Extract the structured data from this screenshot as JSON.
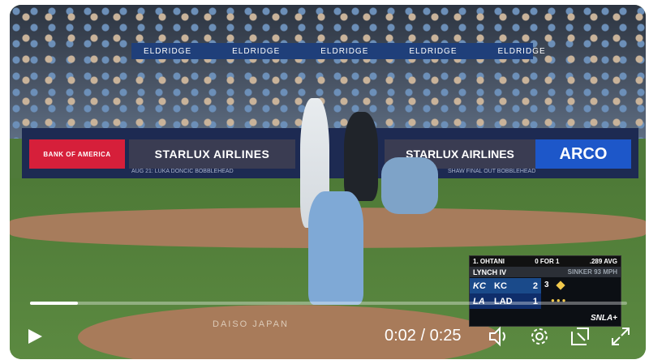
{
  "ads": {
    "eldridge": [
      "ELDRIDGE",
      "ELDRIDGE",
      "ELDRIDGE",
      "ELDRIDGE",
      "ELDRIDGE"
    ],
    "bank": "BANK OF AMERICA",
    "starlux": "STARLUX AIRLINES",
    "arco": "ARCO",
    "promo1": "AUG 21: LUKA DONCIC BOBBLEHEAD",
    "promo2": "SHAW FINAL OUT BOBBLEHEAD",
    "mound": "DAISO JAPAN"
  },
  "scorebug": {
    "batter": "1. OHTANI",
    "batter_stat": "0 FOR 1",
    "batter_avg": ".289 AVG",
    "pitcher": "LYNCH IV",
    "pitch_info": "SINKER 93 MPH",
    "teams": [
      {
        "logo": "KC",
        "abbr": "KC",
        "score": "2"
      },
      {
        "logo": "LA",
        "abbr": "LAD",
        "score": "1"
      }
    ],
    "inning": "3",
    "network": "SNLA+"
  },
  "player": {
    "time": "0:02 / 0:25",
    "progress": 0.08
  }
}
